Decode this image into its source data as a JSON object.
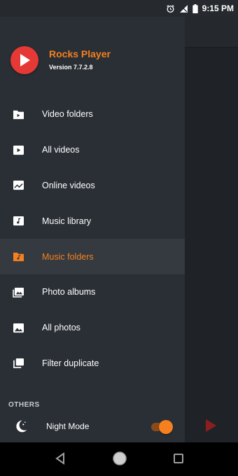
{
  "status_bar": {
    "time": "9:15 PM",
    "icons": [
      "alarm-icon",
      "signal-icon",
      "battery-icon"
    ]
  },
  "drawer": {
    "app_name": "Rocks Player",
    "version": "Version 7.7.2.8",
    "items": [
      {
        "label": "Video folders",
        "icon": "folder-icon",
        "active": false
      },
      {
        "label": "All videos",
        "icon": "video-icon",
        "active": false
      },
      {
        "label": "Online videos",
        "icon": "trending-icon",
        "active": false
      },
      {
        "label": "Music library",
        "icon": "music-note-icon",
        "active": false
      },
      {
        "label": "Music folders",
        "icon": "music-folder-icon",
        "active": true
      },
      {
        "label": "Photo albums",
        "icon": "photo-album-icon",
        "active": false
      },
      {
        "label": "All photos",
        "icon": "image-icon",
        "active": false
      },
      {
        "label": "Filter duplicate",
        "icon": "duplicate-icon",
        "active": false
      }
    ],
    "section_others": "OTHERS",
    "night_mode": {
      "label": "Night Mode",
      "enabled": true
    }
  },
  "colors": {
    "accent": "#f5801f",
    "logo": "#e53935",
    "drawer_bg": "#2a2f35",
    "active_bg": "#343a40"
  }
}
